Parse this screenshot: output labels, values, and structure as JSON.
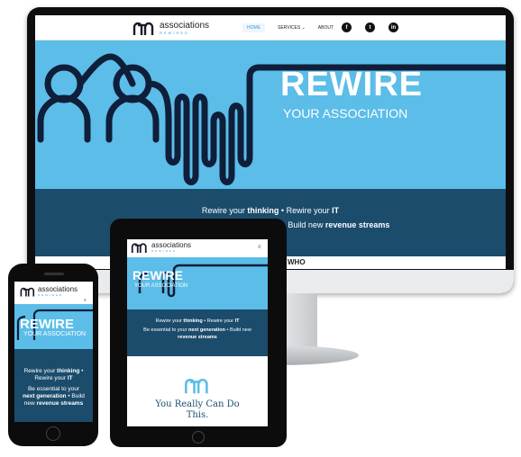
{
  "brand": {
    "name": "associations",
    "tagline": "REWIRED",
    "accent": "#3aa0d8",
    "hero_blue": "#5bbde8",
    "band_navy": "#1b4c6c"
  },
  "nav": {
    "home": "HOME",
    "services": "SERVICES",
    "services_caret": "⌄",
    "about": "ABOUT",
    "social": [
      {
        "icon": "facebook-icon",
        "glyph": "f"
      },
      {
        "icon": "twitter-icon",
        "glyph": "t"
      },
      {
        "icon": "linkedin-icon",
        "glyph": "in"
      }
    ]
  },
  "hero": {
    "title": "REWIRE",
    "subtitle": "YOUR ASSOCIATION"
  },
  "band": {
    "desktop": {
      "p1": "Rewire your ",
      "b1": "thinking",
      "p2": " • Rewire your ",
      "b2": "IT",
      "p3": "Be essential to your next generation • Build new ",
      "b3": "revenue streams"
    },
    "tablet": {
      "p1": "Rewire your ",
      "b1": "thinking",
      "p2": " • Rewire your ",
      "b2": "IT",
      "p3": "Be essential to your ",
      "b3": "next generation",
      "p4": " • Build new",
      "b4": "revenue streams"
    },
    "phone": {
      "p1": "Rewire your ",
      "b1": "thinking",
      "p2": " •",
      "p3": "Rewire your ",
      "b2": "IT",
      "p4": "Be essential to your",
      "b3": "next generation",
      "p5": " • Build",
      "p6": "new ",
      "b4": "revenue streams"
    }
  },
  "tablet": {
    "menu_icon": "≡",
    "tag_line1": "You Really Can Do",
    "tag_line2": "This."
  },
  "phone": {
    "menu_icon": "≡"
  },
  "desktop_bottom_peek": "WHO"
}
